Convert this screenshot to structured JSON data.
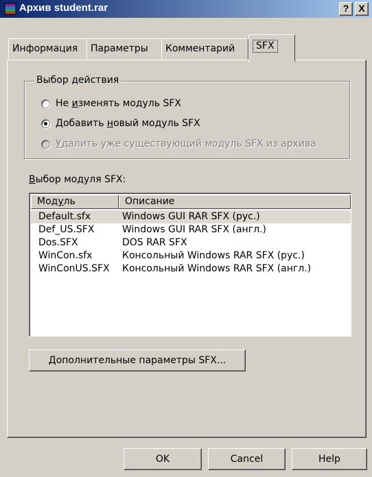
{
  "window": {
    "title": "Архив student.rar",
    "help_button": "?",
    "close_button": "X"
  },
  "tabs": [
    {
      "label": "Информация",
      "active": false
    },
    {
      "label": "Параметры",
      "active": false
    },
    {
      "label": "Комментарий",
      "active": false
    },
    {
      "label": "SFX",
      "active": true
    }
  ],
  "action_group": {
    "legend": "Выбор действия",
    "options": [
      {
        "pre": "Не ",
        "accel": "и",
        "post": "зменять модуль SFX",
        "checked": false,
        "enabled": true
      },
      {
        "pre": "Добавить ",
        "accel": "н",
        "post": "овый модуль SFX",
        "checked": true,
        "enabled": true
      },
      {
        "pre": "",
        "accel": "У",
        "post": "далить уже существующий модуль SFX из архива",
        "checked": false,
        "enabled": false
      }
    ]
  },
  "module_list": {
    "label_accel": "В",
    "label_rest": "ыбор модуля SFX:",
    "columns": {
      "module_pre": "Мод",
      "module_accel": "у",
      "module_post": "ль",
      "description": "Описание"
    },
    "rows": [
      {
        "module": "Default.sfx",
        "description": "Windows GUI RAR SFX (рус.)",
        "selected": true
      },
      {
        "module": "Def_US.SFX",
        "description": "Windows GUI RAR SFX (англ.)",
        "selected": false
      },
      {
        "module": "Dos.SFX",
        "description": "DOS RAR SFX",
        "selected": false
      },
      {
        "module": "WinCon.sfx",
        "description": "Консольный Windows RAR SFX (рус.)",
        "selected": false
      },
      {
        "module": "WinConUS.SFX",
        "description": "Консольный Windows RAR SFX (англ.)",
        "selected": false
      }
    ]
  },
  "advanced_button": {
    "accel": "Д",
    "rest": "ополнительные параметры SFX..."
  },
  "footer": {
    "ok": "OK",
    "cancel": "Cancel",
    "help": "Help"
  },
  "colors": {
    "titlebar_start": "#0a246a",
    "titlebar_end": "#a6caf0",
    "face": "#d4d0c8"
  }
}
